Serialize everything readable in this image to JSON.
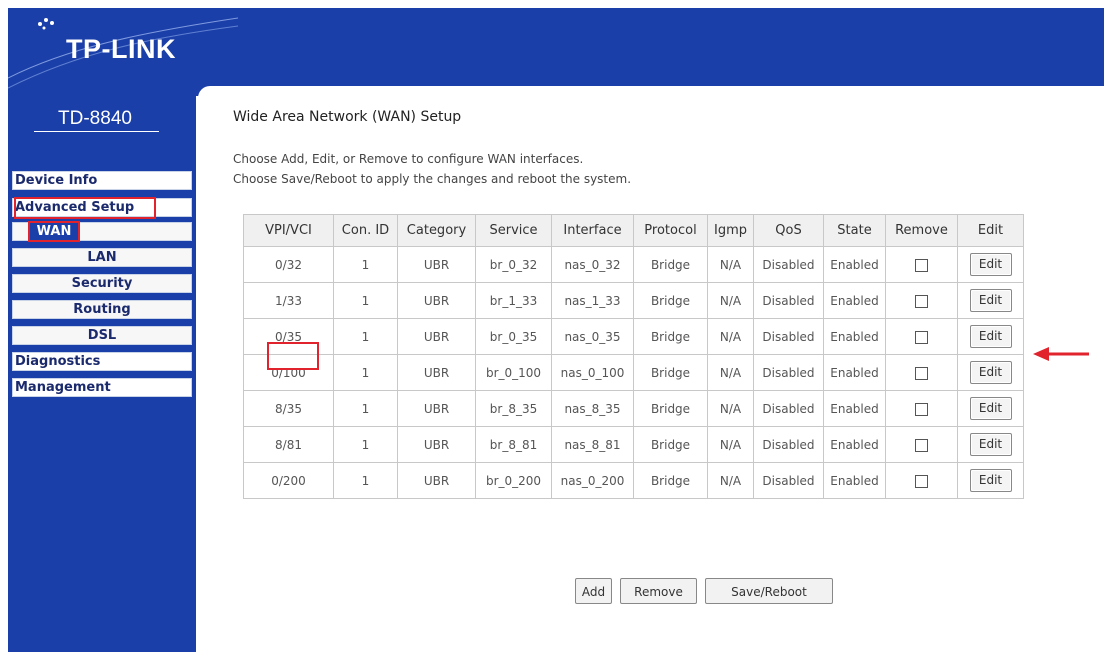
{
  "brand": {
    "logo": "TP-LINK",
    "model": "TD-8840"
  },
  "sidebar": {
    "items": [
      {
        "label": "Device Info"
      },
      {
        "label": "Advanced Setup"
      },
      {
        "label": "WAN"
      },
      {
        "label": "LAN"
      },
      {
        "label": "Security"
      },
      {
        "label": "Routing"
      },
      {
        "label": "DSL"
      },
      {
        "label": "Diagnostics"
      },
      {
        "label": "Management"
      }
    ]
  },
  "page": {
    "title": "Wide Area Network (WAN) Setup",
    "desc1": "Choose Add, Edit, or Remove to configure WAN interfaces.",
    "desc2": "Choose Save/Reboot to apply the changes and reboot the system."
  },
  "table": {
    "headers": [
      "VPI/VCI",
      "Con. ID",
      "Category",
      "Service",
      "Interface",
      "Protocol",
      "Igmp",
      "QoS",
      "State",
      "Remove",
      "Edit"
    ],
    "rows": [
      {
        "vpivci": "0/32",
        "conid": "1",
        "category": "UBR",
        "service": "br_0_32",
        "interface": "nas_0_32",
        "protocol": "Bridge",
        "igmp": "N/A",
        "qos": "Disabled",
        "state": "Enabled",
        "edit": "Edit"
      },
      {
        "vpivci": "1/33",
        "conid": "1",
        "category": "UBR",
        "service": "br_1_33",
        "interface": "nas_1_33",
        "protocol": "Bridge",
        "igmp": "N/A",
        "qos": "Disabled",
        "state": "Enabled",
        "edit": "Edit"
      },
      {
        "vpivci": "0/35",
        "conid": "1",
        "category": "UBR",
        "service": "br_0_35",
        "interface": "nas_0_35",
        "protocol": "Bridge",
        "igmp": "N/A",
        "qos": "Disabled",
        "state": "Enabled",
        "edit": "Edit"
      },
      {
        "vpivci": "0/100",
        "conid": "1",
        "category": "UBR",
        "service": "br_0_100",
        "interface": "nas_0_100",
        "protocol": "Bridge",
        "igmp": "N/A",
        "qos": "Disabled",
        "state": "Enabled",
        "edit": "Edit"
      },
      {
        "vpivci": "8/35",
        "conid": "1",
        "category": "UBR",
        "service": "br_8_35",
        "interface": "nas_8_35",
        "protocol": "Bridge",
        "igmp": "N/A",
        "qos": "Disabled",
        "state": "Enabled",
        "edit": "Edit"
      },
      {
        "vpivci": "8/81",
        "conid": "1",
        "category": "UBR",
        "service": "br_8_81",
        "interface": "nas_8_81",
        "protocol": "Bridge",
        "igmp": "N/A",
        "qos": "Disabled",
        "state": "Enabled",
        "edit": "Edit"
      },
      {
        "vpivci": "0/200",
        "conid": "1",
        "category": "UBR",
        "service": "br_0_200",
        "interface": "nas_0_200",
        "protocol": "Bridge",
        "igmp": "N/A",
        "qos": "Disabled",
        "state": "Enabled",
        "edit": "Edit"
      }
    ]
  },
  "buttons": {
    "add": "Add",
    "remove": "Remove",
    "save_reboot": "Save/Reboot"
  },
  "colors": {
    "brand_blue": "#1b3fa8",
    "highlight_red": "#e0232c"
  }
}
